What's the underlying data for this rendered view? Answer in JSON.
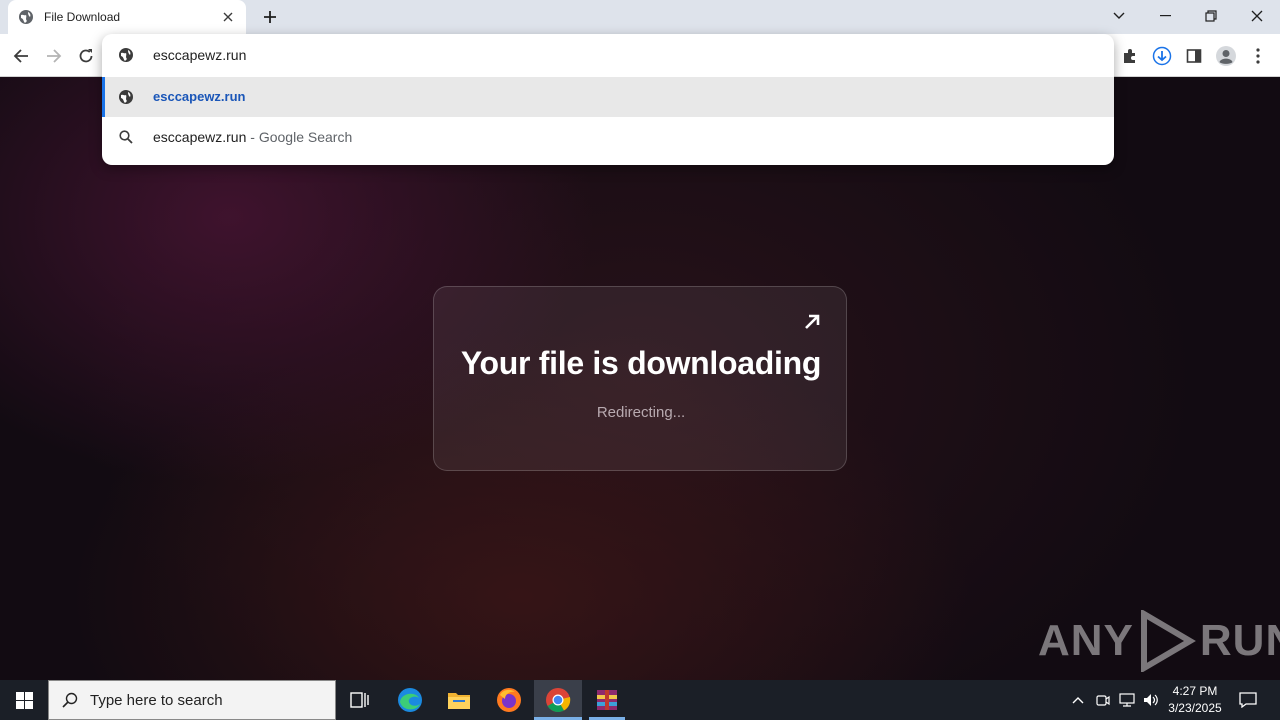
{
  "tab": {
    "title": "File Download"
  },
  "omnibox": {
    "input": "esccapewz.run",
    "suggestions": [
      {
        "text": "esccapewz.run",
        "suffix": "",
        "icon": "globe-icon",
        "selected": true
      },
      {
        "text": "esccapewz.run",
        "suffix": " - Google Search",
        "icon": "search-icon",
        "selected": false
      }
    ]
  },
  "page": {
    "headline": "Your file is downloading",
    "status": "Redirecting..."
  },
  "watermark": {
    "left": "ANY",
    "right": "RUN"
  },
  "taskbar": {
    "search_placeholder": "Type here to search",
    "time": "4:27 PM",
    "date": "3/23/2025"
  }
}
